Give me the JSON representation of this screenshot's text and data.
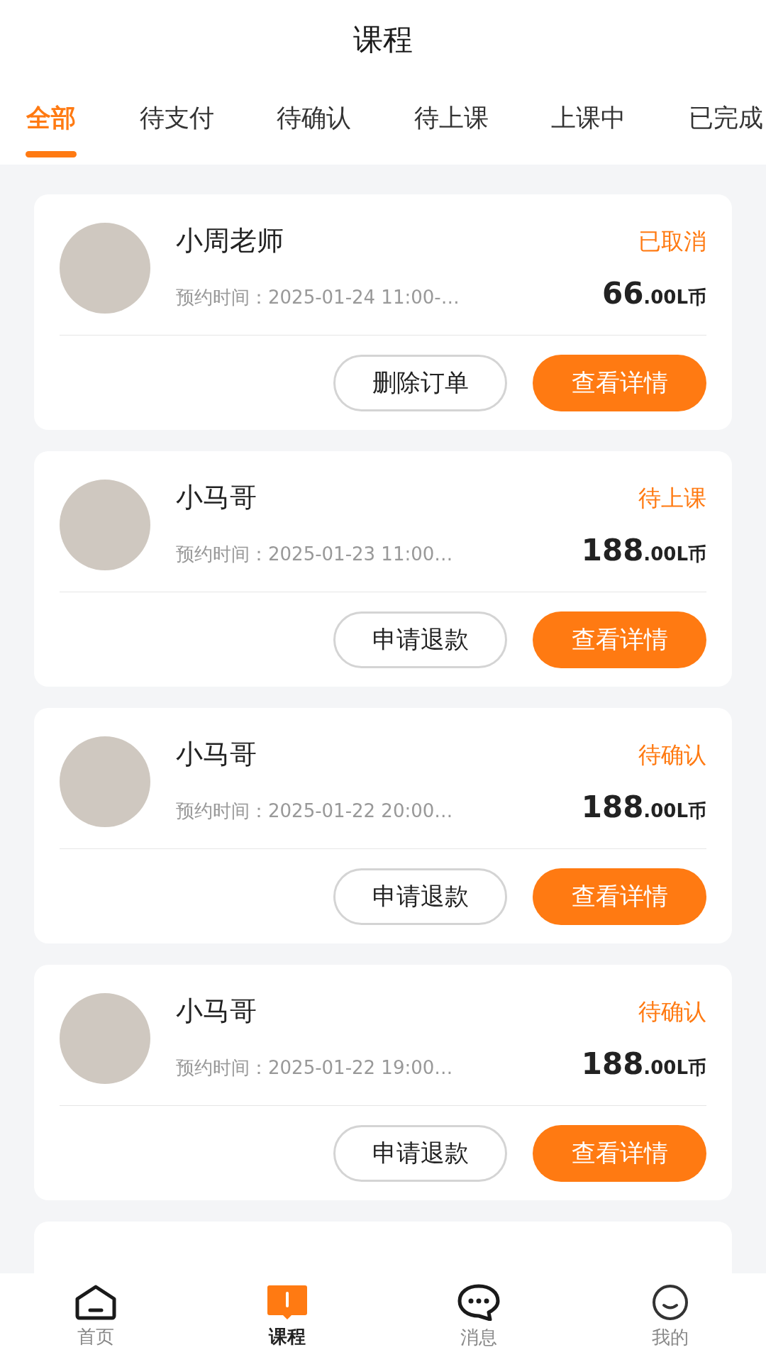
{
  "header": {
    "title": "课程"
  },
  "tabs": [
    {
      "label": "全部",
      "selected": true
    },
    {
      "label": "待支付",
      "selected": false
    },
    {
      "label": "待确认",
      "selected": false
    },
    {
      "label": "待上课",
      "selected": false
    },
    {
      "label": "上课中",
      "selected": false
    },
    {
      "label": "已完成",
      "selected": false
    }
  ],
  "orders": [
    {
      "teacher": "小周老师",
      "status": "已取消",
      "time": "预约时间：2025-01-24 11:00-…",
      "price_integer": "66",
      "price_decimal": ".00",
      "currency": "L币",
      "buttons": [
        {
          "label": "删除订单",
          "kind": "outline"
        },
        {
          "label": "查看详情",
          "kind": "primary"
        }
      ]
    },
    {
      "teacher": "小马哥",
      "status": "待上课",
      "time": "预约时间：2025-01-23 11:00…",
      "price_integer": "188",
      "price_decimal": ".00",
      "currency": "L币",
      "buttons": [
        {
          "label": "申请退款",
          "kind": "outline"
        },
        {
          "label": "查看详情",
          "kind": "primary"
        }
      ]
    },
    {
      "teacher": "小马哥",
      "status": "待确认",
      "time": "预约时间：2025-01-22 20:00…",
      "price_integer": "188",
      "price_decimal": ".00",
      "currency": "L币",
      "buttons": [
        {
          "label": "申请退款",
          "kind": "outline"
        },
        {
          "label": "查看详情",
          "kind": "primary"
        }
      ]
    },
    {
      "teacher": "小马哥",
      "status": "待确认",
      "time": "预约时间：2025-01-22 19:00…",
      "price_integer": "188",
      "price_decimal": ".00",
      "currency": "L币",
      "buttons": [
        {
          "label": "申请退款",
          "kind": "outline"
        },
        {
          "label": "查看详情",
          "kind": "primary"
        }
      ]
    }
  ],
  "bottom_nav": [
    {
      "label": "首页",
      "kind": "home",
      "selected": false
    },
    {
      "label": "课程",
      "kind": "book",
      "selected": true
    },
    {
      "label": "消息",
      "kind": "chat",
      "selected": false
    },
    {
      "label": "我的",
      "kind": "smile",
      "selected": false
    }
  ]
}
